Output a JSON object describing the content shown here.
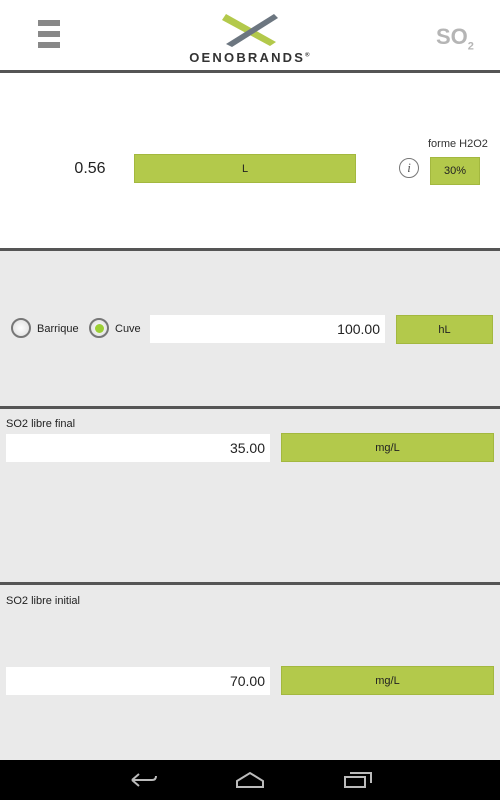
{
  "header": {
    "menu_icon": "hamburger-icon",
    "brand": "OENOBRANDS",
    "brand_mark": "®",
    "title": "SO",
    "title_sub": "2"
  },
  "result": {
    "value": "0.56",
    "unit_button": "L",
    "info_icon": "info-icon",
    "h2o2_label": "forme H2O2",
    "h2o2_button": "30%"
  },
  "volume": {
    "options": [
      {
        "label": "Barrique",
        "selected": false
      },
      {
        "label": "Cuve",
        "selected": true
      }
    ],
    "value": "100.00",
    "unit_button": "hL"
  },
  "so2_final": {
    "label": "SO2 libre final",
    "value": "35.00",
    "unit_button": "mg/L"
  },
  "so2_initial": {
    "label": "SO2 libre initial",
    "value": "70.00",
    "unit_button": "mg/L"
  },
  "navbar": {
    "icons": [
      "back-icon",
      "home-icon",
      "recent-apps-icon"
    ]
  },
  "colors": {
    "accent": "#b3c94b",
    "divider": "#555555",
    "background": "#eaeaea"
  }
}
